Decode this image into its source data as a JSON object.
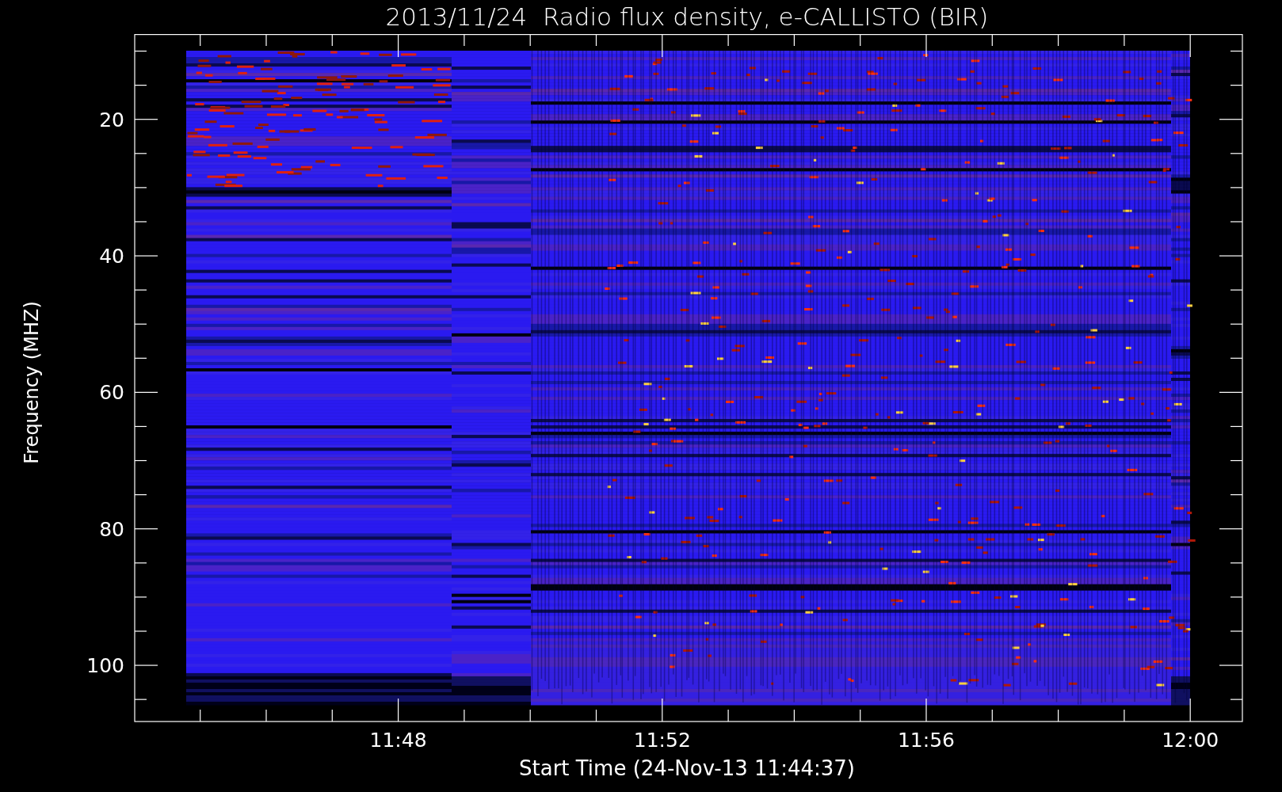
{
  "title": "2013/11/24  Radio flux density, e-CALLISTO (BIR)",
  "y_axis": {
    "label": "Frequency (MHZ)",
    "ticks": [
      "20",
      "40",
      "60",
      "80",
      "100"
    ]
  },
  "x_axis": {
    "label": "Start Time (24-Nov-13 11:44:37)",
    "ticks": [
      "11:48",
      "11:52",
      "11:56",
      "12:00"
    ]
  }
}
